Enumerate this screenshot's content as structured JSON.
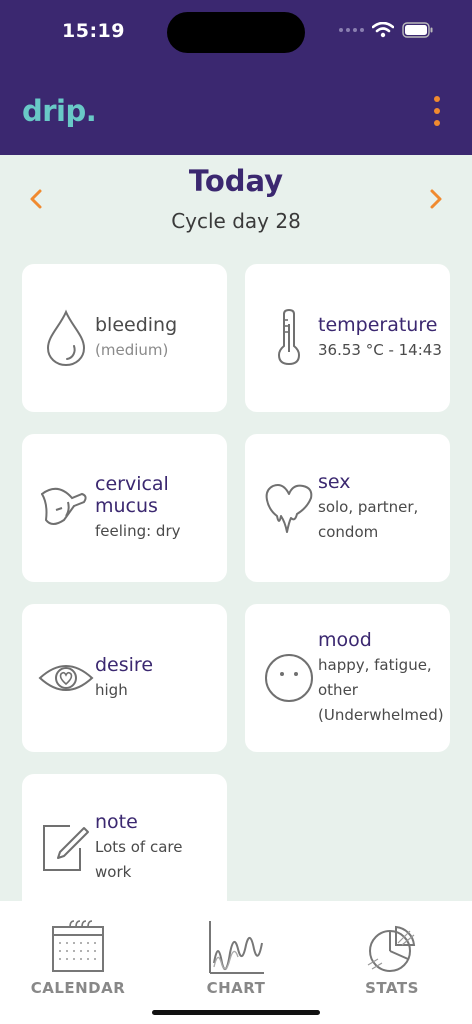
{
  "status_bar": {
    "time": "15:19"
  },
  "app": {
    "logo": "drip."
  },
  "date_nav": {
    "title": "Today",
    "cycle_day": "Cycle day 28"
  },
  "cards": [
    {
      "title": "bleeding",
      "value": "(medium)",
      "icon": "drop-icon"
    },
    {
      "title": "temperature",
      "value": "36.53 °C - 14:43",
      "icon": "thermometer-icon"
    },
    {
      "title": "cervical mucus",
      "value": "feeling: dry",
      "icon": "mucus-icon"
    },
    {
      "title": "sex",
      "value": "solo, partner, condom",
      "icon": "melting-heart-icon"
    },
    {
      "title": "desire",
      "value": "high",
      "icon": "eye-heart-icon"
    },
    {
      "title": "mood",
      "value": "happy, fatigue, other (Underwhelmed)",
      "icon": "neutral-face-icon"
    },
    {
      "title": "note",
      "value": "Lots of care work",
      "icon": "pencil-note-icon"
    }
  ],
  "bottom_nav": [
    {
      "label": "CALENDAR",
      "icon": "calendar-icon"
    },
    {
      "label": "CHART",
      "icon": "chart-icon"
    },
    {
      "label": "STATS",
      "icon": "pie-chart-icon"
    }
  ],
  "colors": {
    "header": "#3b2870",
    "accent": "#f08a2f",
    "logo": "#69c9c7",
    "background": "#e8f1ec"
  }
}
